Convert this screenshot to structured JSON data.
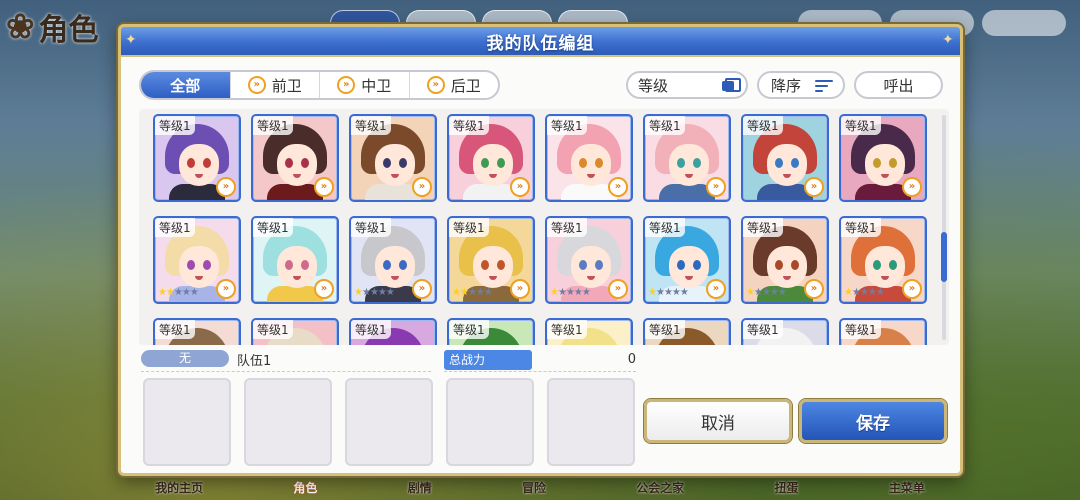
{
  "background": {
    "screen_title": "角色",
    "bottom_nav": [
      {
        "label": "我的主页",
        "active": false
      },
      {
        "label": "角色",
        "active": true
      },
      {
        "label": "剧情",
        "active": false
      },
      {
        "label": "冒险",
        "active": false
      },
      {
        "label": "公会之家",
        "active": false
      },
      {
        "label": "扭蛋",
        "active": false
      },
      {
        "label": "主菜单",
        "active": false
      }
    ]
  },
  "modal": {
    "title": "我的队伍编组",
    "filter_tabs": [
      {
        "label": "全部",
        "active": true,
        "icon": "none"
      },
      {
        "label": "前卫",
        "active": false,
        "icon": "front-icon"
      },
      {
        "label": "中卫",
        "active": false,
        "icon": "middle-icon"
      },
      {
        "label": "后卫",
        "active": false,
        "icon": "back-icon"
      }
    ],
    "sort_field": "等级",
    "sort_order": "降序",
    "call_button": "呼出",
    "level_label": "等级1",
    "characters": [
      {
        "hair": "#6d4fb3",
        "eye": "#c23a3a",
        "bg": "#d9c7ef",
        "body": "#2b2b3b",
        "stars": 0
      },
      {
        "hair": "#4a2d2a",
        "eye": "#a8324a",
        "bg": "#f4c8c8",
        "body": "#6b1b1b",
        "stars": 0
      },
      {
        "hair": "#7a4a2a",
        "eye": "#3a3a6a",
        "bg": "#f4d4b8",
        "body": "#e9e2d8",
        "stars": 0
      },
      {
        "hair": "#d8567a",
        "eye": "#3f9a52",
        "bg": "#f7d0dc",
        "body": "#f2f2f2",
        "stars": 0
      },
      {
        "hair": "#f2a2b0",
        "eye": "#d98a2a",
        "bg": "#fbe3ea",
        "body": "#fafafa",
        "stars": 0
      },
      {
        "hair": "#f2b0b8",
        "eye": "#3aa0a0",
        "bg": "#fadce4",
        "body": "#4a6fa8",
        "stars": 0
      },
      {
        "hair": "#c2443a",
        "eye": "#3a7ac2",
        "bg": "#9fd3e0",
        "body": "#3a5aa0",
        "stars": 0
      },
      {
        "hair": "#4a2a4a",
        "eye": "#c49a2a",
        "bg": "#e8a8c0",
        "body": "#6a1a3a",
        "stars": 0
      },
      {
        "hair": "#f4dca8",
        "eye": "#a04ab0",
        "bg": "#f4dcec",
        "body": "#a8b4e8",
        "stars": 2
      },
      {
        "hair": "#9ee0e0",
        "eye": "#d06a8a",
        "bg": "#dff4f4",
        "body": "#f2c84a",
        "stars": 0
      },
      {
        "hair": "#c8c8cc",
        "eye": "#3a6ac2",
        "bg": "#e0e4f4",
        "body": "#3a3a4a",
        "stars": 1
      },
      {
        "hair": "#e8c04a",
        "eye": "#c2542a",
        "bg": "#f4d89a",
        "body": "#8a6a3a",
        "stars": 2
      },
      {
        "hair": "#d8d8dc",
        "eye": "#5a7ac2",
        "bg": "#f7d0dc",
        "body": "#f2a8b8",
        "stars": 1
      },
      {
        "hair": "#3aa8e0",
        "eye": "#2a6ac2",
        "bg": "#bfe4f4",
        "body": "#e8f2fa",
        "stars": 1
      },
      {
        "hair": "#6a3a2a",
        "eye": "#a84a2a",
        "bg": "#f4d4c0",
        "body": "#4a8a3a",
        "stars": 1
      },
      {
        "hair": "#e0703a",
        "eye": "#2a9a7a",
        "bg": "#f7d8c8",
        "body": "#c84a3a",
        "stars": 1
      },
      {
        "hair": "#8a6a4a",
        "eye": "#3a3a3a",
        "bg": "#f4dcd4",
        "body": "#f2f2f2",
        "stars": 0
      },
      {
        "hair": "#e8dcc8",
        "eye": "#7a4a2a",
        "bg": "#f4c0c8",
        "body": "#c23a4a",
        "stars": 0
      },
      {
        "hair": "#8a3ab0",
        "eye": "#c23a7a",
        "bg": "#d8a8e0",
        "body": "#6a2a8a",
        "stars": 0
      },
      {
        "hair": "#3a8a3a",
        "eye": "#d8a02a",
        "bg": "#c8e8b8",
        "body": "#f2f2f2",
        "stars": 0
      },
      {
        "hair": "#f2e08a",
        "eye": "#3a8ac2",
        "bg": "#fbf0c8",
        "body": "#f2f2f2",
        "stars": 0
      },
      {
        "hair": "#8a5a2a",
        "eye": "#3a6a3a",
        "bg": "#ecd8c0",
        "body": "#f2f2f2",
        "stars": 0
      },
      {
        "hair": "#f2f2f2",
        "eye": "#3a3a6a",
        "bg": "#dcdce8",
        "body": "#3a3a4a",
        "stars": 0
      },
      {
        "hair": "#d8804a",
        "eye": "#3a3a3a",
        "bg": "#f7d8c8",
        "body": "#f2f2f2",
        "stars": 0
      }
    ],
    "team": {
      "tag": "无",
      "name": "队伍1",
      "power_label": "总战力",
      "power_value": "0",
      "slots": 5
    },
    "cancel_button": "取消",
    "save_button": "保存"
  },
  "colors": {
    "accent_blue": "#2d5bb8",
    "gold_border": "#d7c07a",
    "role_icon": "#f0a020"
  }
}
